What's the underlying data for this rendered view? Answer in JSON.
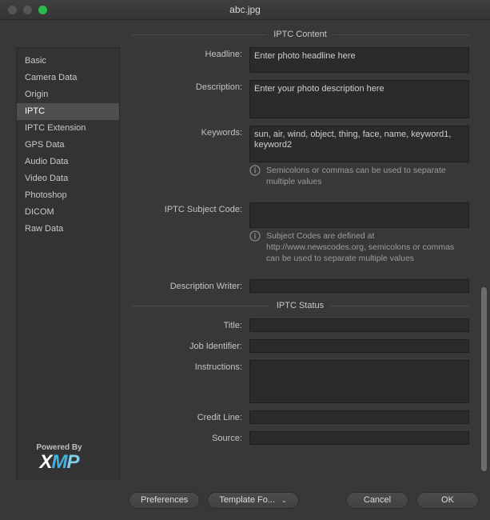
{
  "window": {
    "title": "abc.jpg",
    "traffic_lights": [
      "close",
      "minimize",
      "maximize"
    ]
  },
  "sidebar": {
    "items": [
      {
        "label": "Basic",
        "selected": false
      },
      {
        "label": "Camera Data",
        "selected": false
      },
      {
        "label": "Origin",
        "selected": false
      },
      {
        "label": "IPTC",
        "selected": true
      },
      {
        "label": "IPTC Extension",
        "selected": false
      },
      {
        "label": "GPS Data",
        "selected": false
      },
      {
        "label": "Audio Data",
        "selected": false
      },
      {
        "label": "Video Data",
        "selected": false
      },
      {
        "label": "Photoshop",
        "selected": false
      },
      {
        "label": "DICOM",
        "selected": false
      },
      {
        "label": "Raw Data",
        "selected": false
      }
    ],
    "powered_by": "Powered By",
    "logo": {
      "x": "X",
      "m": "M",
      "p": "P",
      "accent": "#46b1e0"
    }
  },
  "sections": {
    "iptc_content": {
      "title": "IPTC Content",
      "headline": {
        "label": "Headline:",
        "value": "Enter photo headline here",
        "placeholder": ""
      },
      "description": {
        "label": "Description:",
        "value": "Enter your photo description here",
        "placeholder": ""
      },
      "keywords": {
        "label": "Keywords:",
        "value": "sun, air, wind, object, thing, face, name, keyword1, keyword2",
        "placeholder": "",
        "hint": "Semicolons or commas can be used to separate multiple values"
      },
      "subject_code": {
        "label": "IPTC Subject Code:",
        "value": "",
        "placeholder": "",
        "hint": "Subject Codes are defined at http://www.newscodes.org, semicolons or commas can be used to separate multiple values"
      },
      "description_writer": {
        "label": "Description Writer:",
        "value": "",
        "placeholder": ""
      }
    },
    "iptc_status": {
      "title": "IPTC Status",
      "title_field": {
        "label": "Title:",
        "value": "",
        "placeholder": ""
      },
      "job_identifier": {
        "label": "Job Identifier:",
        "value": "",
        "placeholder": ""
      },
      "instructions": {
        "label": "Instructions:",
        "value": "",
        "placeholder": ""
      },
      "credit_line": {
        "label": "Credit Line:",
        "value": "",
        "placeholder": ""
      },
      "source": {
        "label": "Source:",
        "value": "",
        "placeholder": ""
      }
    }
  },
  "footer": {
    "preferences": "Preferences",
    "template": "Template Fo...",
    "template_caret": "⌄",
    "cancel": "Cancel",
    "ok": "OK"
  },
  "scroll": {
    "vertical_position_pct": 55,
    "horizontal_position_pct": 0,
    "accent": "#4fa3dd"
  }
}
